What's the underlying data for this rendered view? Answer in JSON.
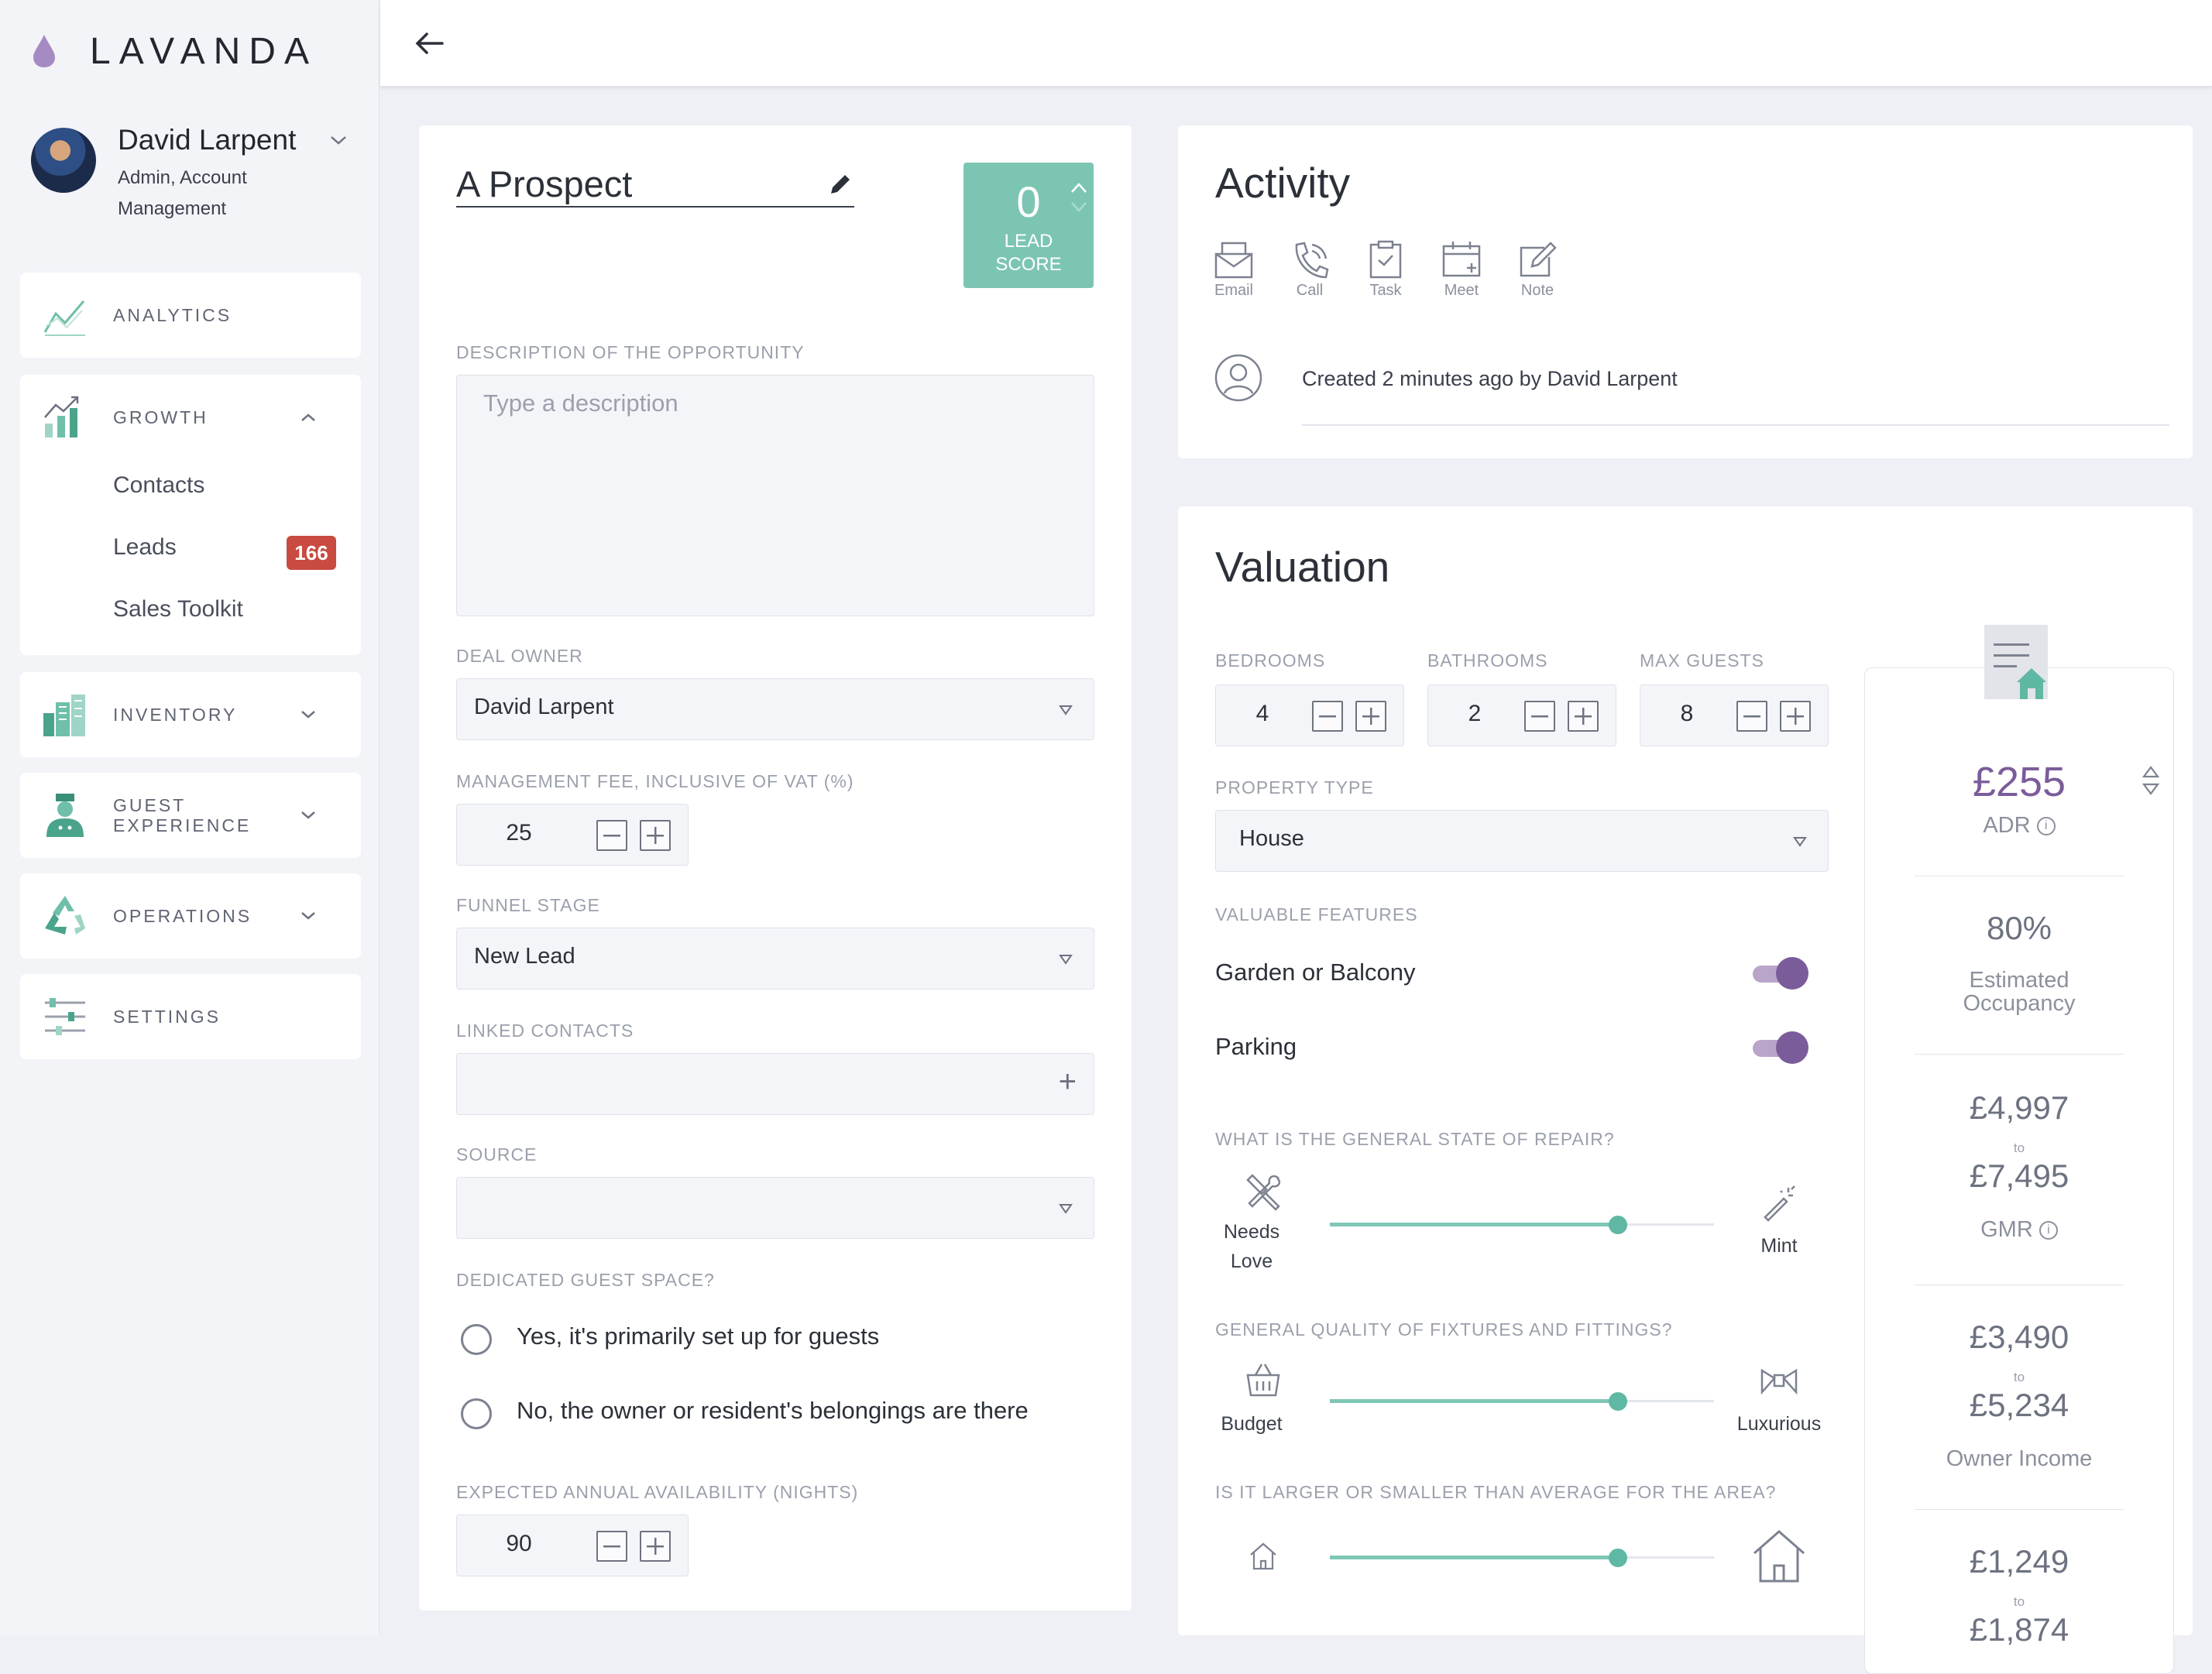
{
  "brand": {
    "name": "LAVANDA",
    "accent": "#7b5c9a",
    "teal": "#6fbfaa"
  },
  "user": {
    "name": "David Larpent",
    "role": "Admin, Account Management"
  },
  "nav": {
    "analytics": "ANALYTICS",
    "growth": "GROWTH",
    "growth_items": [
      {
        "label": "Contacts"
      },
      {
        "label": "Leads",
        "badge": "166"
      },
      {
        "label": "Sales Toolkit"
      }
    ],
    "inventory": "INVENTORY",
    "guest_experience_line1": "GUEST",
    "guest_experience_line2": "EXPERIENCE",
    "operations": "OPERATIONS",
    "settings": "SETTINGS"
  },
  "deal": {
    "title": "A Prospect",
    "lead_score_value": "0",
    "lead_score_label_1": "LEAD",
    "lead_score_label_2": "SCORE",
    "description_label": "DESCRIPTION OF THE OPPORTUNITY",
    "description_placeholder": "Type a description",
    "owner_label": "DEAL OWNER",
    "owner_value": "David Larpent",
    "fee_label": "MANAGEMENT FEE, INCLUSIVE OF VAT (%)",
    "fee_value": "25",
    "funnel_label": "FUNNEL STAGE",
    "funnel_value": "New Lead",
    "linked_label": "LINKED CONTACTS",
    "linked_add": "+",
    "source_label": "SOURCE",
    "source_value": "",
    "guest_space_label": "DEDICATED GUEST SPACE?",
    "guest_space_options": [
      "Yes, it's primarily set up for guests",
      "No, the owner or resident's belongings are there"
    ],
    "availability_label": "EXPECTED ANNUAL AVAILABILITY (NIGHTS)",
    "availability_value": "90"
  },
  "activity": {
    "title": "Activity",
    "actions": [
      "Email",
      "Call",
      "Task",
      "Meet",
      "Note"
    ],
    "log": "Created 2 minutes ago by David Larpent"
  },
  "valuation": {
    "title": "Valuation",
    "bedrooms_label": "BEDROOMS",
    "bedrooms": "4",
    "bathrooms_label": "BATHROOMS",
    "bathrooms": "2",
    "guests_label": "MAX GUESTS",
    "guests": "8",
    "property_type_label": "PROPERTY TYPE",
    "property_type": "House",
    "features_label": "VALUABLE FEATURES",
    "features": [
      {
        "label": "Garden or Balcony",
        "on": true
      },
      {
        "label": "Parking",
        "on": true
      }
    ],
    "repair_label": "WHAT IS THE GENERAL STATE OF REPAIR?",
    "repair_low_1": "Needs",
    "repair_low_2": "Love",
    "repair_high": "Mint",
    "repair_level": 0.75,
    "quality_label": "GENERAL QUALITY OF FIXTURES AND FITTINGS?",
    "quality_low": "Budget",
    "quality_high": "Luxurious",
    "quality_level": 0.75,
    "size_label": "IS IT LARGER OR SMALLER THAN AVERAGE FOR THE AREA?",
    "size_level": 0.75,
    "stats": {
      "adr": "£255",
      "adr_label": "ADR",
      "occupancy": "80%",
      "occupancy_label_1": "Estimated",
      "occupancy_label_2": "Occupancy",
      "gmr_low": "£4,997",
      "gmr_to": "to",
      "gmr_high": "£7,495",
      "gmr_label": "GMR",
      "owner_low": "£3,490",
      "owner_to": "to",
      "owner_high": "£5,234",
      "owner_label": "Owner Income",
      "other_low": "£1,249",
      "other_to": "to",
      "other_high": "£1,874"
    }
  }
}
